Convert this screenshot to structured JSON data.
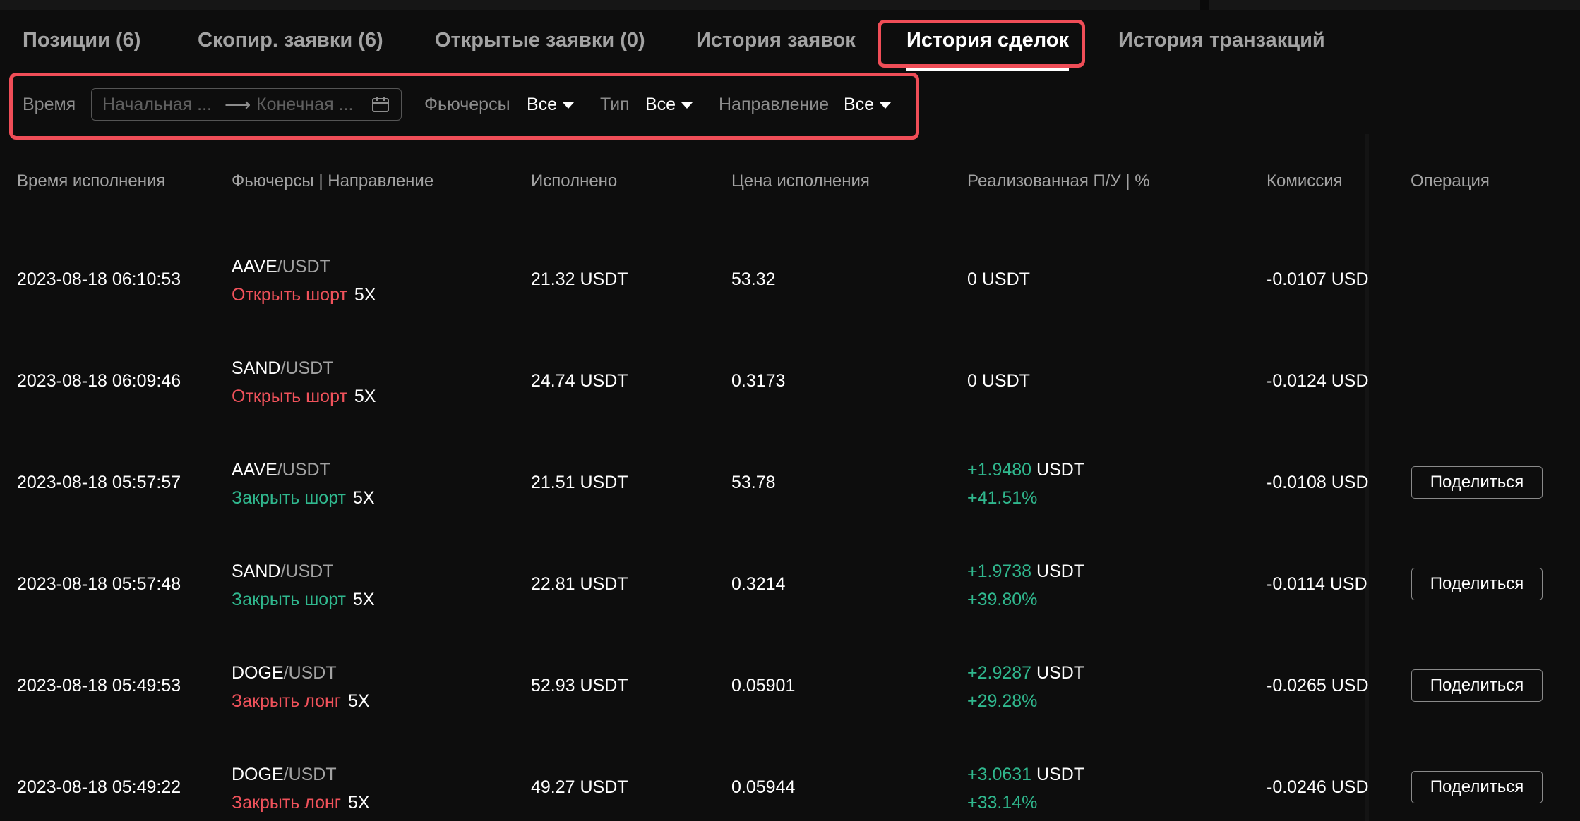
{
  "tabs": [
    {
      "label": "Позиции (6)"
    },
    {
      "label": "Скопир. заявки (6)"
    },
    {
      "label": "Открытые заявки (0)"
    },
    {
      "label": "История заявок"
    },
    {
      "label": "История сделок"
    },
    {
      "label": "История транзакций"
    }
  ],
  "active_tab": "История сделок",
  "filters": {
    "time_label": "Время",
    "start_placeholder": "Начальная ...",
    "end_placeholder": "Конечная ...",
    "arrow": "⟶",
    "futures_label": "Фьючерсы",
    "futures_value": "Все",
    "type_label": "Тип",
    "type_value": "Все",
    "direction_label": "Направление",
    "direction_value": "Все"
  },
  "columns": {
    "time": "Время исполнения",
    "futures": "Фьючерсы | Направление",
    "filled": "Исполнено",
    "price": "Цена исполнения",
    "pnl": "Реализованная П/У | %",
    "fee": "Комиссия",
    "op": "Операция"
  },
  "rows": [
    {
      "time": "2023-08-18 06:10:53",
      "base": "AAVE",
      "quote": "/USDT",
      "side": "Открыть шорт",
      "side_color": "red",
      "leverage": "5X",
      "filled": "21.32  USDT",
      "price": "53.32",
      "pnl_value": "0",
      "pnl_unit": "USDT",
      "pnl_pct": "",
      "fee": "-0.0107 USD",
      "share": ""
    },
    {
      "time": "2023-08-18 06:09:46",
      "base": "SAND",
      "quote": "/USDT",
      "side": "Открыть шорт",
      "side_color": "red",
      "leverage": "5X",
      "filled": "24.74  USDT",
      "price": "0.3173",
      "pnl_value": "0",
      "pnl_unit": "USDT",
      "pnl_pct": "",
      "fee": "-0.0124 USD",
      "share": ""
    },
    {
      "time": "2023-08-18 05:57:57",
      "base": "AAVE",
      "quote": "/USDT",
      "side": "Закрыть шорт",
      "side_color": "green",
      "leverage": "5X",
      "filled": "21.51  USDT",
      "price": "53.78",
      "pnl_value": "+1.9480",
      "pnl_unit": "USDT",
      "pnl_pct": "+41.51%",
      "fee": "-0.0108 USD",
      "share": "Поделиться"
    },
    {
      "time": "2023-08-18 05:57:48",
      "base": "SAND",
      "quote": "/USDT",
      "side": "Закрыть шорт",
      "side_color": "green",
      "leverage": "5X",
      "filled": "22.81  USDT",
      "price": "0.3214",
      "pnl_value": "+1.9738",
      "pnl_unit": "USDT",
      "pnl_pct": "+39.80%",
      "fee": "-0.0114 USD",
      "share": "Поделиться"
    },
    {
      "time": "2023-08-18 05:49:53",
      "base": "DOGE",
      "quote": "/USDT",
      "side": "Закрыть лонг",
      "side_color": "red",
      "leverage": "5X",
      "filled": "52.93  USDT",
      "price": "0.05901",
      "pnl_value": "+2.9287",
      "pnl_unit": "USDT",
      "pnl_pct": "+29.28%",
      "fee": "-0.0265 USD",
      "share": "Поделиться"
    },
    {
      "time": "2023-08-18 05:49:22",
      "base": "DOGE",
      "quote": "/USDT",
      "side": "Закрыть лонг",
      "side_color": "red",
      "leverage": "5X",
      "filled": "49.27  USDT",
      "price": "0.05944",
      "pnl_value": "+3.0631",
      "pnl_unit": "USDT",
      "pnl_pct": "+33.14%",
      "fee": "-0.0246 USD",
      "share": "Поделиться"
    }
  ],
  "colors": {
    "red": "#f0525b",
    "green": "#30b88e",
    "highlight": "#ef4d57"
  },
  "icons": {
    "calendar": "calendar-icon",
    "caret": "caret-down-icon"
  }
}
